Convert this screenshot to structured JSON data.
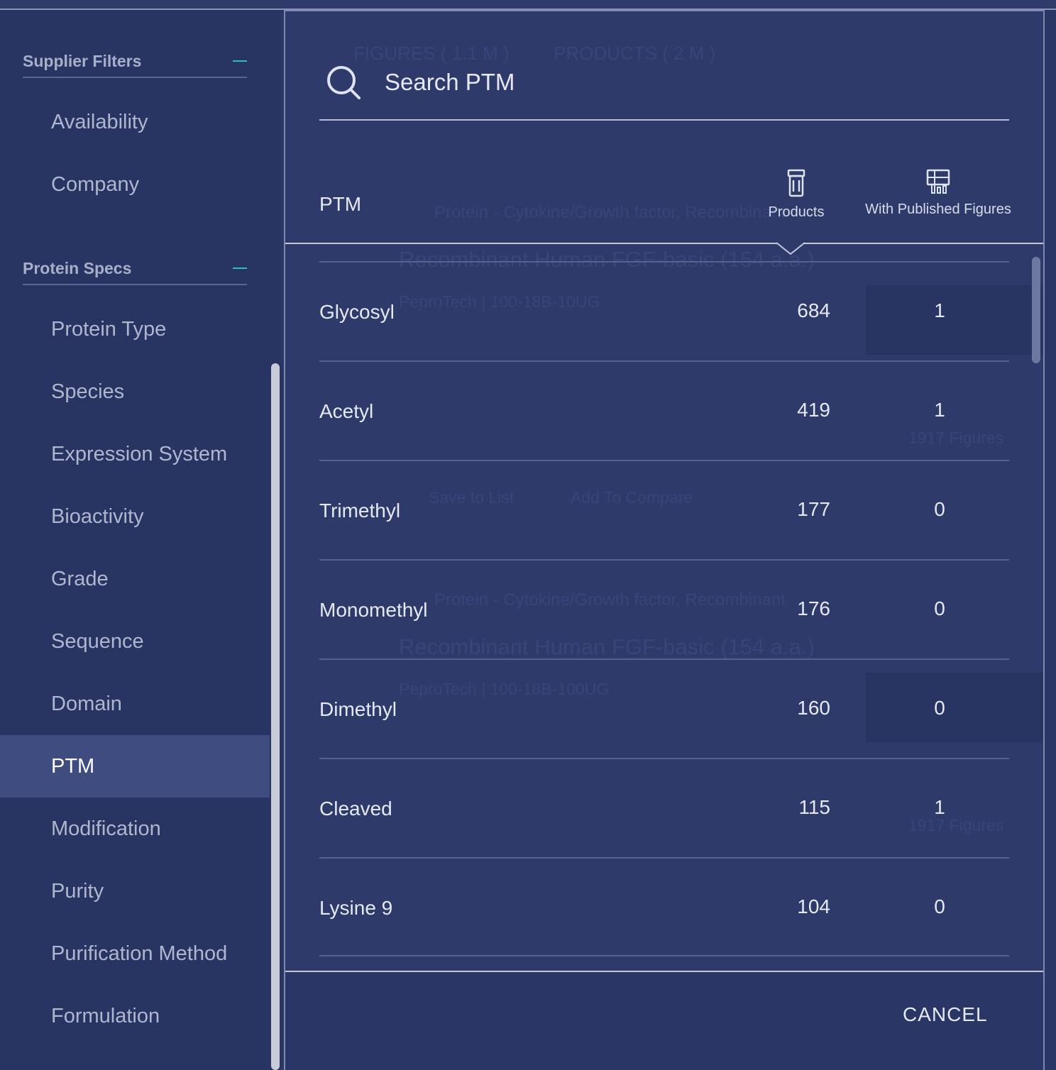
{
  "sidebar": {
    "sections": [
      {
        "title": "Supplier Filters",
        "items": [
          "Availability",
          "Company"
        ]
      },
      {
        "title": "Protein Specs",
        "items": [
          "Protein Type",
          "Species",
          "Expression System",
          "Bioactivity",
          "Grade",
          "Sequence",
          "Domain",
          "PTM",
          "Modification",
          "Purity",
          "Purification Method",
          "Formulation"
        ]
      }
    ],
    "active_item": "PTM"
  },
  "modal": {
    "search": {
      "placeholder": "Search PTM"
    },
    "columns": {
      "name": "PTM",
      "products": "Products",
      "figures": "With Published Figures"
    },
    "rows": [
      {
        "name": "Glycosyl",
        "products": "684",
        "figures": "1"
      },
      {
        "name": "Acetyl",
        "products": "419",
        "figures": "1"
      },
      {
        "name": "Trimethyl",
        "products": "177",
        "figures": "0"
      },
      {
        "name": "Monomethyl",
        "products": "176",
        "figures": "0"
      },
      {
        "name": "Dimethyl",
        "products": "160",
        "figures": "0"
      },
      {
        "name": "Cleaved",
        "products": "115",
        "figures": "1"
      },
      {
        "name": "Lysine 9",
        "products": "104",
        "figures": "0"
      }
    ],
    "cancel_label": "CANCEL"
  },
  "background": {
    "tabs": [
      "FIGURES ( 1.1 M )",
      "PRODUCTS ( 2 M )"
    ],
    "category": "Protein - Cytokine/Growth factor, Recombinant",
    "product_title": "Recombinant Human FGF-basic (154 a.a.)",
    "vendor_1": "PeproTech | 100-18B-10UG",
    "vendor_2": "PeproTech | 100-18B-100UG",
    "figures_count": "1917 Figures",
    "save_label": "Save to List",
    "compare_label": "Add To Compare"
  },
  "colors": {
    "accent": "#2cc0c6",
    "sidebar_bg": "#283563",
    "active_bg": "#3e4c80",
    "modal_bg": "#2e3a69"
  }
}
